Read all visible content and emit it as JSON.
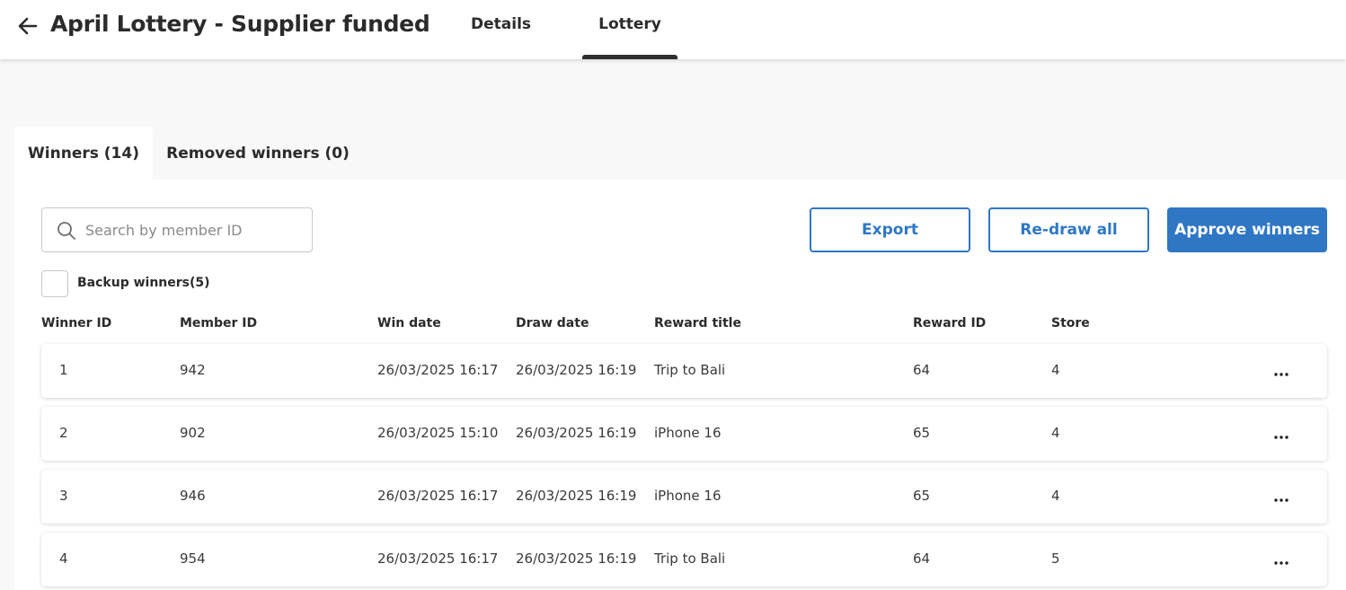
{
  "header": {
    "title": "April Lottery - Supplier funded",
    "tabs": [
      {
        "label": "Details",
        "active": false
      },
      {
        "label": "Lottery",
        "active": true
      }
    ]
  },
  "subtabs": [
    {
      "label": "Winners (14)",
      "active": true
    },
    {
      "label": "Removed winners (0)",
      "active": false
    }
  ],
  "search": {
    "placeholder": "Search by member ID",
    "value": ""
  },
  "actions": {
    "export_label": "Export",
    "redraw_label": "Re-draw all",
    "approve_label": "Approve winners"
  },
  "backup": {
    "label": "Backup winners(5)",
    "checked": false
  },
  "table": {
    "columns": [
      "Winner ID",
      "Member ID",
      "Win date",
      "Draw date",
      "Reward title",
      "Reward ID",
      "Store"
    ],
    "rows": [
      [
        "1",
        "942",
        "26/03/2025 16:17",
        "26/03/2025 16:19",
        "Trip to Bali",
        "64",
        "4"
      ],
      [
        "2",
        "902",
        "26/03/2025 15:10",
        "26/03/2025 16:19",
        "iPhone 16",
        "65",
        "4"
      ],
      [
        "3",
        "946",
        "26/03/2025 16:17",
        "26/03/2025 16:19",
        "iPhone 16",
        "65",
        "4"
      ],
      [
        "4",
        "954",
        "26/03/2025 16:17",
        "26/03/2025 16:19",
        "Trip to Bali",
        "64",
        "5"
      ]
    ]
  },
  "icons": {
    "back": "arrow-left-icon",
    "search": "search-icon",
    "row_menu": "more-horizontal-icon"
  },
  "colors": {
    "accent": "#2f77c5",
    "text": "#2b2b2b",
    "background": "#f8f8f8"
  }
}
